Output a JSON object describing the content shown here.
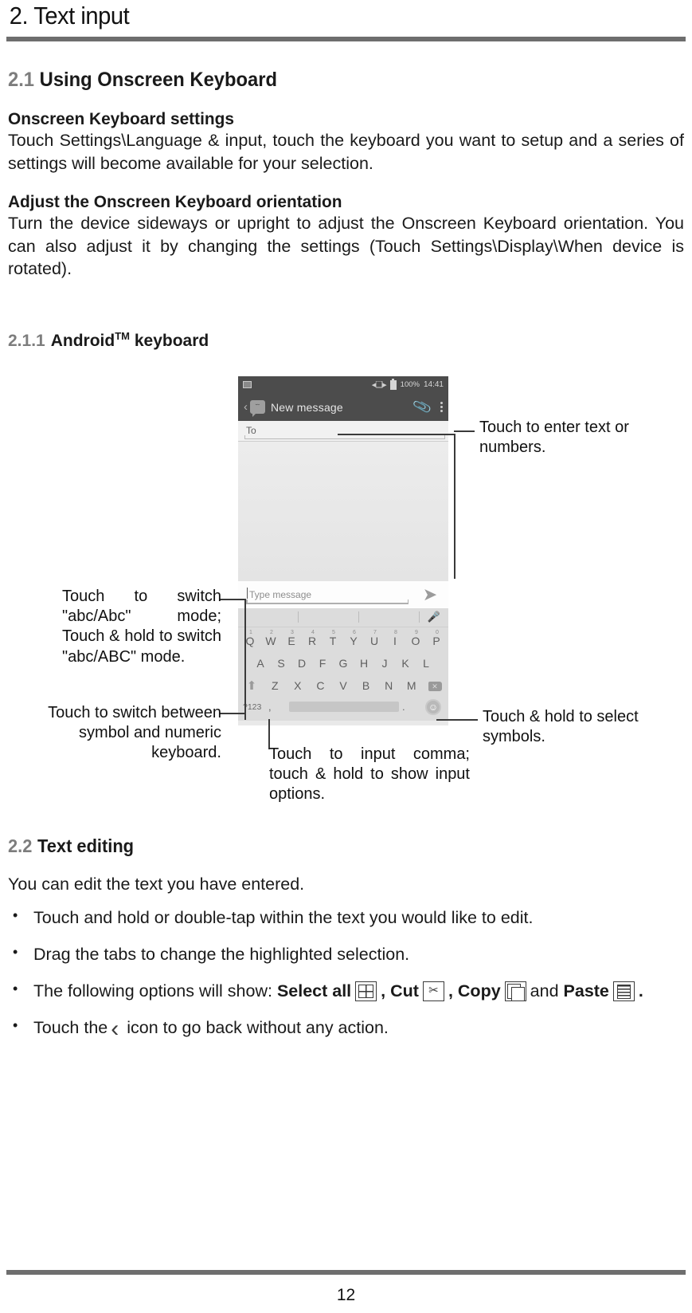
{
  "chapter": {
    "title": "2. Text input"
  },
  "section_21": {
    "number": "2.1",
    "title": "Using Onscreen Keyboard",
    "sub1_title": "Onscreen Keyboard settings",
    "sub1_body": "Touch Settings\\Language & input, touch the keyboard you want to setup and a series of settings will become available for your selection.",
    "sub2_title": "Adjust the Onscreen Keyboard orientation",
    "sub2_body": "Turn the device sideways or upright to adjust the Onscreen Keyboard orientation. You can also adjust it by changing the settings (Touch Settings\\Display\\When device is rotated)."
  },
  "section_211": {
    "number": "2.1.1",
    "title_main": "Android",
    "title_tm": "TM",
    "title_rest": "keyboard"
  },
  "phone": {
    "statusbar": {
      "image_icon": "image-icon",
      "vibrate_icon": "vibrate-icon",
      "battery_icon": "battery-icon",
      "battery_pct": "100%",
      "time": "14:41"
    },
    "appbar": {
      "back_icon": "back-chevron-icon",
      "avatar_icon": "smiley-avatar-icon",
      "avatar_face": "˘˘",
      "title": "New message",
      "attach_icon": "paperclip-icon",
      "overflow_icon": "kebab-menu-icon"
    },
    "to_field": {
      "label": "To"
    },
    "compose": {
      "placeholder": "Type message",
      "send_icon": "send-arrow-icon"
    },
    "suggestions": {
      "mic_icon": "microphone-icon"
    },
    "keyboard": {
      "row1": [
        {
          "key": "Q",
          "num": "1"
        },
        {
          "key": "W",
          "num": "2"
        },
        {
          "key": "E",
          "num": "3"
        },
        {
          "key": "R",
          "num": "4"
        },
        {
          "key": "T",
          "num": "5"
        },
        {
          "key": "Y",
          "num": "6"
        },
        {
          "key": "U",
          "num": "7"
        },
        {
          "key": "I",
          "num": "8"
        },
        {
          "key": "O",
          "num": "9"
        },
        {
          "key": "P",
          "num": "0"
        }
      ],
      "row2": [
        "A",
        "S",
        "D",
        "F",
        "G",
        "H",
        "J",
        "K",
        "L"
      ],
      "row3": [
        "Z",
        "X",
        "C",
        "V",
        "B",
        "N",
        "M"
      ],
      "shift_icon": "shift-arrow-icon",
      "delete_icon": "backspace-icon",
      "symbols_key": "?123",
      "comma_key": ",",
      "period_key": ".",
      "space_key": "",
      "emoji_icon": "emoji-smiley-icon",
      "emoji_glyph": "☺"
    }
  },
  "callouts": {
    "enter_text": "Touch to enter text or numbers.",
    "abc_mode": "Touch to switch \"abc/Abc\" mode; Touch & hold to switch \"abc/ABC\" mode.",
    "symbol_numeric": "Touch to switch between symbol and numeric keyboard.",
    "select_symbols": "Touch & hold to select symbols.",
    "input_comma": "Touch to input comma; touch & hold to show input options."
  },
  "section_22": {
    "number": "2.2",
    "title": "Text editing",
    "lead": "You can edit the text you have entered.",
    "bullets": [
      {
        "kind": "plain",
        "text": "Touch and hold or double-tap within the text you would like to edit."
      },
      {
        "kind": "plain",
        "text": "Drag the tabs to change the highlighted selection."
      },
      {
        "kind": "options",
        "prefix": "The following options will show: ",
        "select_all_label": "Select all",
        "select_all_icon": "select-all-icon",
        "comma1": ", ",
        "cut_label": "Cut",
        "cut_icon": "cut-scissors-icon",
        "comma2": ", ",
        "copy_label": "Copy",
        "copy_icon": "copy-icon",
        "and_label": "and",
        "paste_label": "Paste",
        "paste_icon": "paste-icon",
        "end": "."
      },
      {
        "kind": "back",
        "prefix": "Touch the",
        "back_icon": "back-chevron-icon",
        "suffix": "icon to go back without any action."
      }
    ]
  },
  "footer": {
    "page_number": "12"
  },
  "colors": {
    "rule": "#6e6e6e",
    "section_number": "#7d7d7d",
    "text": "#111111",
    "phone_chrome": "#4c4c4c",
    "keyboard_bg": "#dcdcdc"
  }
}
